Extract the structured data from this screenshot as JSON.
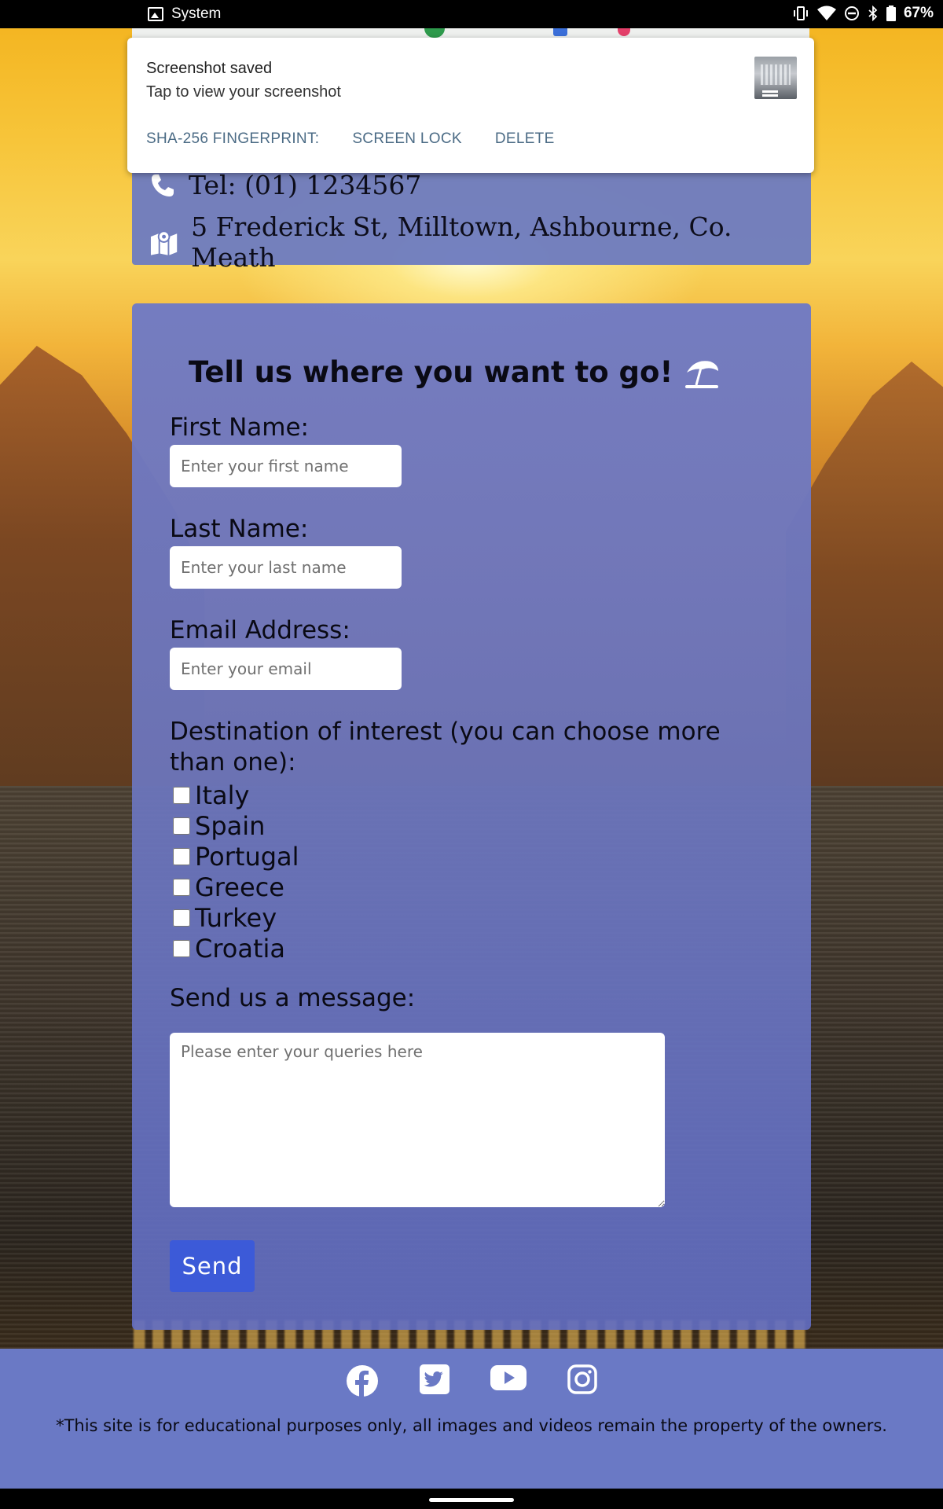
{
  "status_bar": {
    "app_name": "System",
    "battery": "67%"
  },
  "notification": {
    "title": "Screenshot saved",
    "subtitle": "Tap to view your screenshot",
    "actions": [
      "SHA-256 FINGERPRINT:",
      "SCREEN LOCK",
      "DELETE"
    ]
  },
  "contact": {
    "tel": "Tel: (01) 1234567",
    "address": "5 Frederick St, Milltown, Ashbourne, Co. Meath"
  },
  "form": {
    "heading": "Tell us where you want to go!",
    "heading_icon": "beach-umbrella-icon",
    "first_name": {
      "label": "First Name:",
      "placeholder": "Enter your first name"
    },
    "last_name": {
      "label": "Last Name:",
      "placeholder": "Enter your last name"
    },
    "email": {
      "label": "Email Address:",
      "placeholder": "Enter your email"
    },
    "destination_label": "Destination of interest (you can choose more than one):",
    "destinations": [
      "Italy",
      "Spain",
      "Portugal",
      "Greece",
      "Turkey",
      "Croatia"
    ],
    "message": {
      "label": "Send us a message:",
      "placeholder": "Please enter your queries here"
    },
    "send_label": "Send"
  },
  "footer": {
    "social_icons": [
      "facebook-icon",
      "twitter-icon",
      "youtube-icon",
      "instagram-icon"
    ],
    "disclaimer": "*This site is for educational purposes only, all images and videos remain the property of the owners."
  },
  "colors": {
    "card": "#6e7cc0",
    "button": "#3c5ad8",
    "footer": "#6a79c5",
    "notification_action": "#4b6b85"
  }
}
